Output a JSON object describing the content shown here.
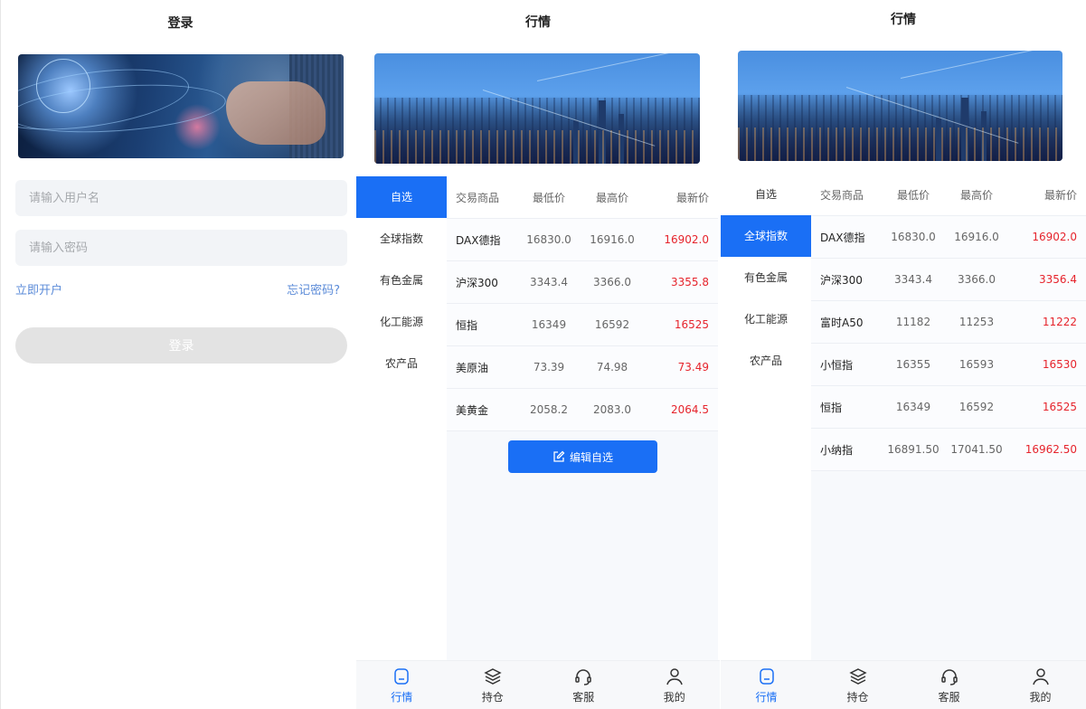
{
  "login": {
    "title": "登录",
    "username_placeholder": "请输入用户名",
    "password_placeholder": "请输入密码",
    "register_link": "立即开户",
    "forgot_link": "忘记密码?",
    "login_button": "登录"
  },
  "market_favorites": {
    "title": "行情",
    "sidebar": [
      "自选",
      "全球指数",
      "有色金属",
      "化工能源",
      "农产品"
    ],
    "active_index": 0,
    "headers": [
      "交易商品",
      "最低价",
      "最高价",
      "最新价"
    ],
    "rows": [
      [
        "DAX德指",
        "16830.0",
        "16916.0",
        "16902.0"
      ],
      [
        "沪深300",
        "3343.4",
        "3366.0",
        "3355.8"
      ],
      [
        "恒指",
        "16349",
        "16592",
        "16525"
      ],
      [
        "美原油",
        "73.39",
        "74.98",
        "73.49"
      ],
      [
        "美黄金",
        "2058.2",
        "2083.0",
        "2064.5"
      ]
    ],
    "edit_button": "编辑自选"
  },
  "market_global": {
    "title": "行情",
    "sidebar": [
      "自选",
      "全球指数",
      "有色金属",
      "化工能源",
      "农产品"
    ],
    "active_index": 1,
    "headers": [
      "交易商品",
      "最低价",
      "最高价",
      "最新价"
    ],
    "rows": [
      [
        "DAX德指",
        "16830.0",
        "16916.0",
        "16902.0"
      ],
      [
        "沪深300",
        "3343.4",
        "3366.0",
        "3356.4"
      ],
      [
        "富时A50",
        "11182",
        "11253",
        "11222"
      ],
      [
        "小恒指",
        "16355",
        "16593",
        "16530"
      ],
      [
        "恒指",
        "16349",
        "16592",
        "16525"
      ],
      [
        "小纳指",
        "16891.50",
        "17041.50",
        "16962.50"
      ]
    ]
  },
  "tabbar": {
    "items": [
      {
        "label": "行情",
        "icon": "market-icon"
      },
      {
        "label": "持仓",
        "icon": "layers-icon"
      },
      {
        "label": "客服",
        "icon": "headset-icon"
      },
      {
        "label": "我的",
        "icon": "user-icon"
      }
    ],
    "active_index": 0
  },
  "colors": {
    "accent": "#1a6ff5",
    "price_up": "#e6242c",
    "link": "#5b8bd8"
  }
}
